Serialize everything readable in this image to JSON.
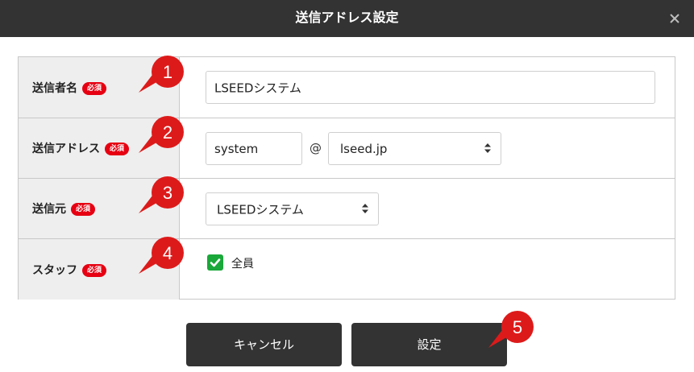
{
  "dialog": {
    "title": "送信アドレス設定",
    "close_icon": "close-icon"
  },
  "form": {
    "required_badge": "必須",
    "sender_name": {
      "label": "送信者名",
      "value": "LSEEDシステム"
    },
    "sender_address": {
      "label": "送信アドレス",
      "local_part": "system",
      "at_symbol": "@",
      "domain": "lseed.jp"
    },
    "sender_source": {
      "label": "送信元",
      "value": "LSEEDシステム"
    },
    "staff": {
      "label": "スタッフ",
      "checkbox_label": "全員",
      "checked": true
    }
  },
  "buttons": {
    "cancel": "キャンセル",
    "save": "設定"
  },
  "markers": [
    "1",
    "2",
    "3",
    "4",
    "5"
  ],
  "colors": {
    "titlebar": "#333333",
    "required_badge": "#e60012",
    "marker": "#dd1a1a",
    "checkbox": "#1aa83a",
    "button": "#333333"
  }
}
